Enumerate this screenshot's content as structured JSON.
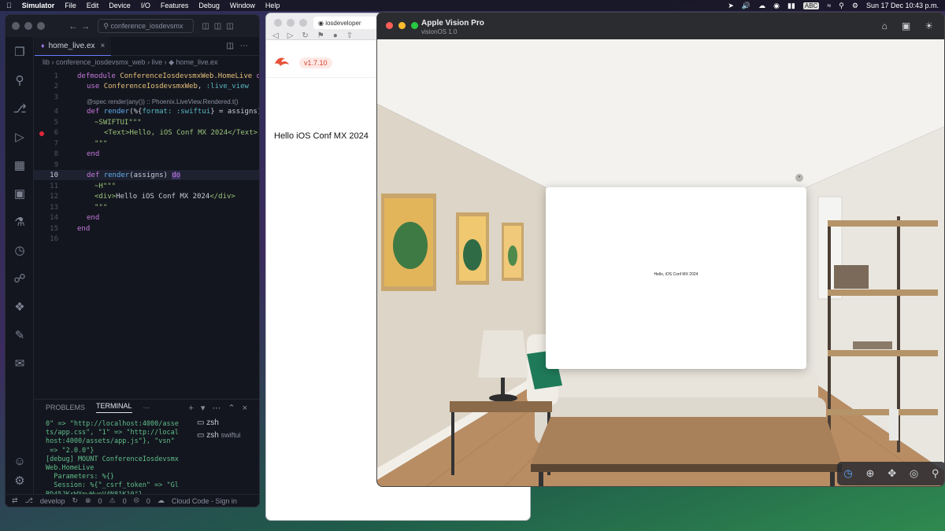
{
  "menubar": {
    "apple": "",
    "app_name": "Simulator",
    "menus": [
      "File",
      "Edit",
      "Device",
      "I/O",
      "Features",
      "Debug",
      "Window",
      "Help"
    ],
    "input_source": "ABC",
    "clock": "Sun 17 Dec  10:43 p.m."
  },
  "vscode": {
    "search": "conference_iosdevsmx",
    "tab": "home_live.ex",
    "breadcrumb": "lib › conference_iosdevsmx_web › live › ◆ home_live.ex",
    "line_numbers": [
      "1",
      "2",
      "3",
      "4",
      "5",
      "6",
      "7",
      "8",
      "9",
      "10",
      "11",
      "12",
      "13",
      "14",
      "15",
      "16"
    ],
    "code": {
      "l1a": "defmodule ",
      "l1b": "ConferenceIosdevsmxWeb.HomeLive",
      "l1c": " do",
      "l2a": "use ",
      "l2b": "ConferenceIosdevsmxWeb",
      "l2c": ", ",
      "l2d": ":live_view",
      "spec": "@spec render(any()) :: Phoenix.LiveView.Rendered.t()",
      "l4a": "def ",
      "l4b": "render",
      "l4c": "(%{",
      "l4d": "format:",
      "l4e": " :swiftui",
      "l4f": "} = assigns)",
      "l5": "~SWIFTUI\"\"\"",
      "l6": "<Text>Hello, iOS Conf MX 2024</Text>",
      "l7": "\"\"\"",
      "l8": "end",
      "l10a": "def ",
      "l10b": "render",
      "l10c": "(assigns) ",
      "l10d": "do",
      "l11": "~H\"\"\"",
      "l12a": "<div>",
      "l12b": "Hello iOS Conf MX 2024",
      "l12c": "</div>",
      "l13": "\"\"\"",
      "l14": "end",
      "l15": "end"
    },
    "panel_tabs": [
      "PROBLEMS",
      "TERMINAL"
    ],
    "terminal": "0\" => \"http://localhost:4000/asse\nts/app.css\", \"1\" => \"http://local\nhost:4000/assets/app.js\"}, \"vsn\"\n => \"2.0.0\"}\n[debug] MOUNT ConferenceIosdevsmx\nWeb.HomeLive\n  Parameters: %{}\n  Session: %{\"_csrf_token\" => \"Gl\nBD45JKrWXpwHynV4N81K10\"}\n[debug] Replied in 115µs\n▯",
    "shells": [
      {
        "name": "zsh",
        "sub": ""
      },
      {
        "name": "zsh",
        "sub": "swiftui"
      }
    ],
    "status": {
      "branch": "develop",
      "errors": "0",
      "warnings": "0",
      "ports": "0",
      "cloud": "Cloud Code - Sign in"
    }
  },
  "safari": {
    "tab_title": "iosdeveloper",
    "version": "v1.7.10",
    "body_text": "Hello iOS Conf MX 2024"
  },
  "vision": {
    "title": "Apple Vision Pro",
    "subtitle": "visionOS 1.0",
    "window_text": "Hello, iOS Conf MX 2024"
  }
}
